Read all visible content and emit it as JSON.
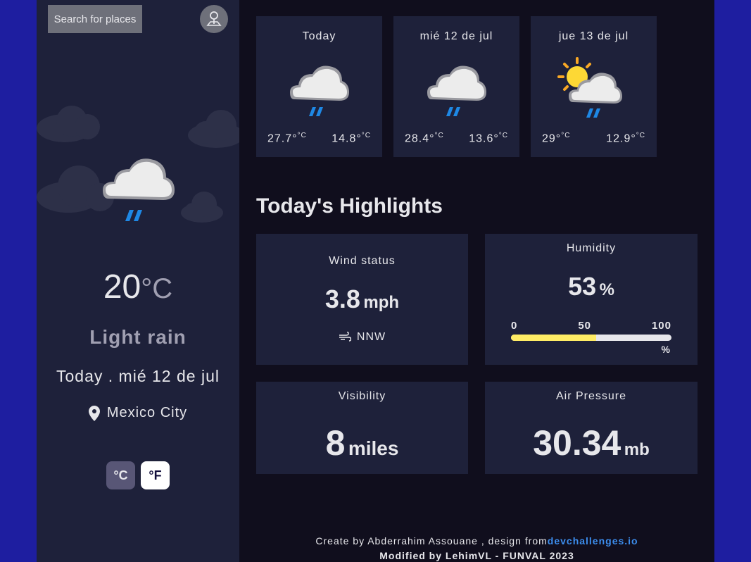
{
  "sidebar": {
    "search_label": "Search for places",
    "current": {
      "temp": "20",
      "unit": "°C",
      "description": "Light rain",
      "date": "Today . mié 12 de jul",
      "location": "Mexico City"
    },
    "units": {
      "celsius": "°C",
      "fahrenheit": "°F"
    }
  },
  "forecast": [
    {
      "day": "Today",
      "max": "27.7°",
      "min": "14.8°",
      "unit": "°C",
      "icon": "light-rain-icon"
    },
    {
      "day": "mié 12 de jul",
      "max": "28.4°",
      "min": "13.6°",
      "unit": "°C",
      "icon": "light-rain-icon"
    },
    {
      "day": "jue 13 de jul",
      "max": "29°",
      "min": "12.9°",
      "unit": "°C",
      "icon": "sun-cloud-rain-icon"
    }
  ],
  "highlights": {
    "title": "Today's Highlights",
    "wind": {
      "label": "Wind status",
      "value": "3.8",
      "unit": "mph",
      "direction": "NNW"
    },
    "humidity": {
      "label": "Humidity",
      "value": "53",
      "unit": "%",
      "ticks": [
        "0",
        "50",
        "100"
      ],
      "percent_label": "%",
      "level": 53
    },
    "visibility": {
      "label": "Visibility",
      "value": "8",
      "unit": "miles"
    },
    "pressure": {
      "label": "Air Pressure",
      "value": "30.34",
      "unit": "mb"
    }
  },
  "footer": {
    "credit_prefix": "Create by Abderrahim Assouane , design from",
    "credit_link": "devchallenges.io",
    "modified": "Modified by LehimVL - FUNVAL 2023"
  },
  "colors": {
    "accent_blue": "#3c8ded",
    "humidity_bar": "#ffec65",
    "panel": "#1e213a",
    "background": "#100e1d",
    "page": "#1e1ea0"
  }
}
